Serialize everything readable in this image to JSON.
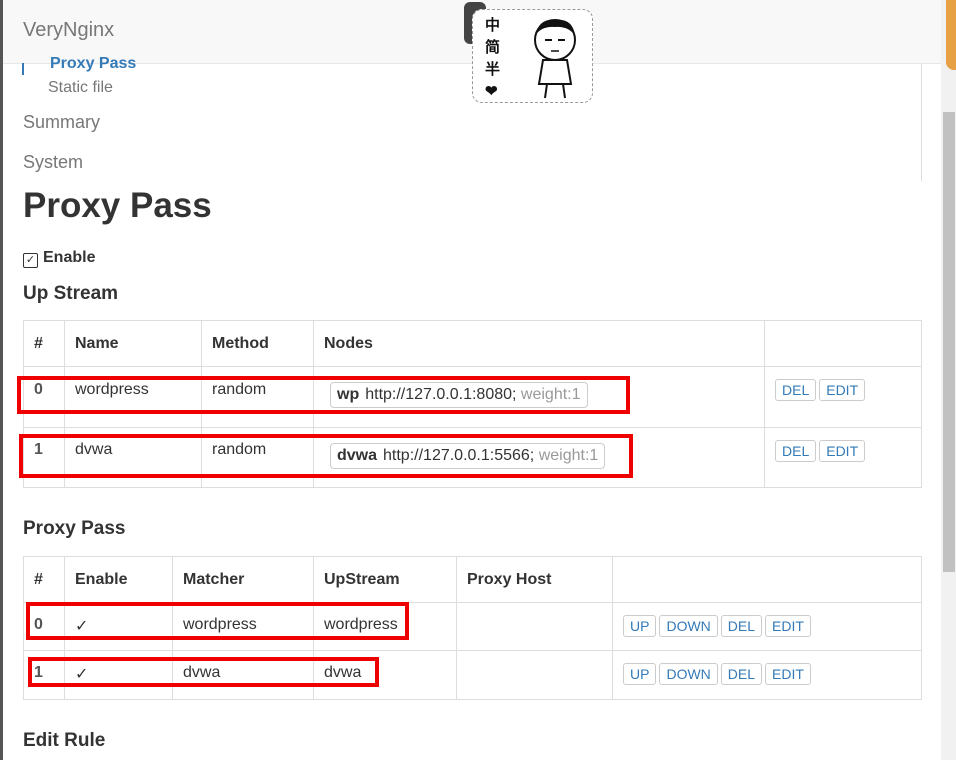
{
  "navbar": {
    "brand": "VeryNginx"
  },
  "sticker": {
    "chars": [
      "中",
      "简",
      "半",
      "❤"
    ]
  },
  "subnav": {
    "active": "Proxy Pass",
    "static_file": "Static file",
    "summary": "Summary",
    "system": "System"
  },
  "page": {
    "title": "Proxy Pass",
    "enable_label": "Enable",
    "enable_checked": true,
    "enable_mark": "✓"
  },
  "upstream": {
    "heading": "Up Stream",
    "columns": [
      "#",
      "Name",
      "Method",
      "Nodes"
    ],
    "rows": [
      {
        "index": "0",
        "name": "wordpress",
        "method": "random",
        "node_name": "wp",
        "node_addr": "http://127.0.0.1:8080;",
        "node_weight": "weight:1"
      },
      {
        "index": "1",
        "name": "dvwa",
        "method": "random",
        "node_name": "dvwa",
        "node_addr": "http://127.0.0.1:5566;",
        "node_weight": "weight:1"
      }
    ],
    "del_label": "DEL",
    "edit_label": "EDIT"
  },
  "proxy_pass": {
    "heading": "Proxy Pass",
    "columns": [
      "#",
      "Enable",
      "Matcher",
      "UpStream",
      "Proxy Host"
    ],
    "rows": [
      {
        "index": "0",
        "enable": "✓",
        "matcher": "wordpress",
        "upstream": "wordpress",
        "proxy_host": ""
      },
      {
        "index": "1",
        "enable": "✓",
        "matcher": "dvwa",
        "upstream": "dvwa",
        "proxy_host": ""
      }
    ],
    "up_label": "UP",
    "down_label": "DOWN",
    "del_label": "DEL",
    "edit_label": "EDIT"
  },
  "edit_rule": {
    "heading": "Edit Rule"
  },
  "colors": {
    "accent": "#337ab7",
    "highlight": "#e00000"
  }
}
